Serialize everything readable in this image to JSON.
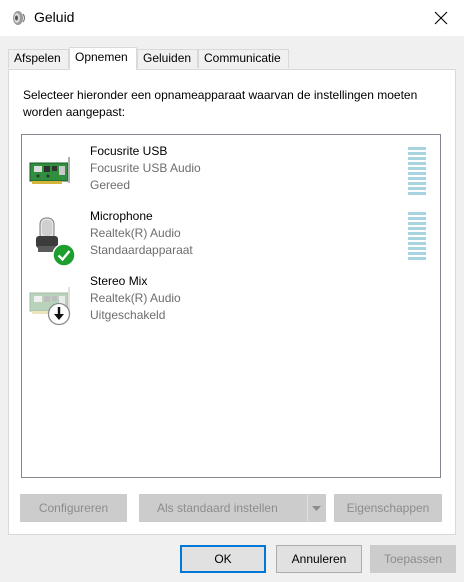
{
  "window": {
    "title": "Geluid",
    "title_icon": "speaker-icon",
    "close_icon": "close-icon"
  },
  "tabs": [
    {
      "label": "Afspelen",
      "active": false
    },
    {
      "label": "Opnemen",
      "active": true
    },
    {
      "label": "Geluiden",
      "active": false
    },
    {
      "label": "Communicatie",
      "active": false
    }
  ],
  "instruction": "Selecteer hieronder een opnameapparaat waarvan de instellingen moeten worden aangepast:",
  "devices": [
    {
      "name": "Focusrite USB",
      "driver": "Focusrite USB Audio",
      "status": "Gereed",
      "icon": "sound-card-icon",
      "status_icon": null
    },
    {
      "name": "Microphone",
      "driver": "Realtek(R) Audio",
      "status": "Standaardapparaat",
      "icon": "microphone-icon",
      "status_icon": "default-check-icon"
    },
    {
      "name": "Stereo Mix",
      "driver": "Realtek(R) Audio",
      "status": "Uitgeschakeld",
      "icon": "sound-card-icon",
      "status_icon": "disabled-arrow-icon"
    }
  ],
  "panel_buttons": {
    "configure": "Configureren",
    "set_default": "Als standaard instellen",
    "properties": "Eigenschappen"
  },
  "dialog_buttons": {
    "ok": "OK",
    "cancel": "Annuleren",
    "apply": "Toepassen"
  },
  "colors": {
    "accent": "#0078d7",
    "level_meter": "#a8d4e0",
    "status_green": "#1e9e2e"
  }
}
